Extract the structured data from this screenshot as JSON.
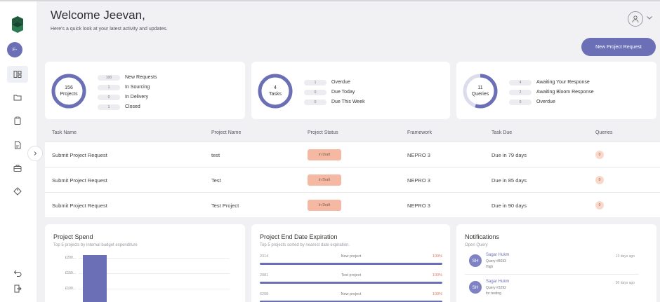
{
  "header": {
    "title": "Welcome Jeevan,",
    "subtitle": "Here's a quick look at your latest activity and updates.",
    "new_request_label": "New Project Request"
  },
  "sidebar": {
    "avatar_initials": "F-",
    "items": [
      {
        "icon": "dashboard-icon",
        "active": true
      },
      {
        "icon": "folder-icon",
        "active": false
      },
      {
        "icon": "clipboard-icon",
        "active": false
      },
      {
        "icon": "document-icon",
        "active": false
      },
      {
        "icon": "briefcase-icon",
        "active": false
      },
      {
        "icon": "tag-icon",
        "active": false
      }
    ],
    "bottom_items": [
      {
        "icon": "back-icon"
      },
      {
        "icon": "logout-icon"
      }
    ]
  },
  "summary_cards": [
    {
      "ring_value": "156",
      "ring_label": "Projects",
      "ring_fraction": 1.0,
      "stats": [
        {
          "count": "100",
          "label": "New Requests"
        },
        {
          "count": "1",
          "label": "In Sourcing"
        },
        {
          "count": "0",
          "label": "In Delivery"
        },
        {
          "count": "1",
          "label": "Closed"
        }
      ]
    },
    {
      "ring_value": "4",
      "ring_label": "Tasks",
      "ring_fraction": 1.0,
      "stats": [
        {
          "count": "1",
          "label": "Overdue"
        },
        {
          "count": "0",
          "label": "Due Today"
        },
        {
          "count": "0",
          "label": "Due This Week"
        }
      ]
    },
    {
      "ring_value": "11",
      "ring_label": "Queries",
      "ring_fraction": 0.55,
      "stats": [
        {
          "count": "4",
          "label": "Awaiting Your Response"
        },
        {
          "count": "2",
          "label": "Awaiting Bloom Response"
        },
        {
          "count": "0",
          "label": "Overdue"
        }
      ]
    }
  ],
  "tasks_table": {
    "headers": [
      "Task Name",
      "Project Name",
      "Project Status",
      "Framework",
      "Task Due",
      "Queries"
    ],
    "rows": [
      {
        "task": "Submit Project Request",
        "project": "test",
        "status": "In Draft",
        "framework": "NEPRO 3",
        "due": "Due in 79 days",
        "queries": "0"
      },
      {
        "task": "Submit Project Request",
        "project": "Test",
        "status": "In Draft",
        "framework": "NEPRO 3",
        "due": "Due in 85 days",
        "queries": "0"
      },
      {
        "task": "Submit Project Request",
        "project": "Test Project",
        "status": "In Draft",
        "framework": "NEPRO 3",
        "due": "Due in 90 days",
        "queries": "0"
      }
    ]
  },
  "project_spend": {
    "title": "Project Spend",
    "subtitle": "Top 5 projects by internal budget expenditure",
    "chart_data": {
      "type": "bar",
      "y_tick_labels": [
        "£200...",
        "£150...",
        "£100..."
      ],
      "bar_fraction_of_visible_height": 1.0
    }
  },
  "end_date_panel": {
    "title": "Project End Date Expiration",
    "subtitle": "Top 5 projects sorted by nearest date expiration.",
    "rows": [
      {
        "code": "2314",
        "name": "New project",
        "percent_label": "100%",
        "percent": 100
      },
      {
        "code": "2081",
        "name": "Test project",
        "percent_label": "100%",
        "percent": 100
      },
      {
        "code": "6208",
        "name": "New project",
        "percent_label": "100%",
        "percent": 100
      }
    ]
  },
  "notifications": {
    "title": "Notifications",
    "subtitle": "Open Query",
    "items": [
      {
        "initials": "SH",
        "name": "Sagar Hukm",
        "query": "Query #8033",
        "priority": "High",
        "time": "13 days ago"
      },
      {
        "initials": "SH",
        "name": "Sagar Hukm",
        "query": "Query #3292",
        "priority": "for testing",
        "time": "50 days ago"
      }
    ]
  },
  "colors": {
    "accent": "#6b70b6",
    "status_draft": "#f5b8a3",
    "percent_text": "#e0765c",
    "background": "#f1f1f4"
  }
}
